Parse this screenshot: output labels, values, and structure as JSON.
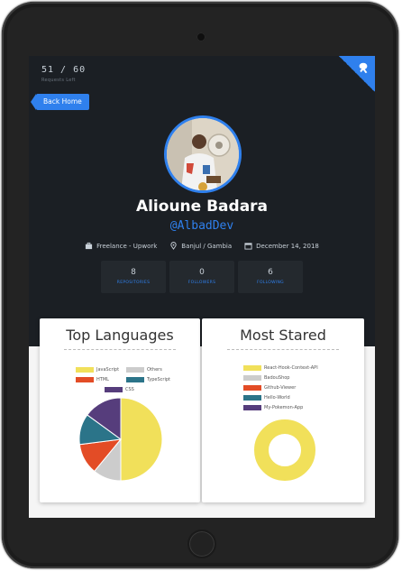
{
  "rate_limit": {
    "count": "51 / 60",
    "label": "Requests Left"
  },
  "nav": {
    "back_label": "Back Home"
  },
  "profile": {
    "name": "Alioune Badara",
    "handle": "@AlbadDev",
    "company": "Freelance - Upwork",
    "location": "Banjul / Gambia",
    "joined": "December 14, 2018"
  },
  "stats": [
    {
      "value": "8",
      "label": "REPOSITORIES"
    },
    {
      "value": "0",
      "label": "FOLLOWERS"
    },
    {
      "value": "6",
      "label": "FOLLOWING"
    }
  ],
  "colors": {
    "accent": "#2f80ed",
    "header_bg": "#1b1f24",
    "stat_bg": "#24292e"
  },
  "icons": {
    "corner": "github-octocat-icon",
    "company": "briefcase-icon",
    "location": "map-pin-icon",
    "joined": "calendar-icon"
  },
  "chart_data": [
    {
      "type": "pie",
      "title": "Top Languages",
      "labels": [
        "JavaScript",
        "Others",
        "HTML",
        "TypeScript",
        "CSS"
      ],
      "colors": [
        "#f1e05a",
        "#cccccc",
        "#e34c26",
        "#2b7489",
        "#563d7c"
      ],
      "values": [
        50,
        11,
        12,
        12,
        15
      ]
    },
    {
      "type": "pie",
      "title": "Most Stared",
      "doughnut": true,
      "labels": [
        "React-Hook-Context-API",
        "BadouShop",
        "Github-Viewer",
        "Hello-World",
        "My-Pokemon-App"
      ],
      "colors": [
        "#f1e05a",
        "#cccccc",
        "#e34c26",
        "#2b7489",
        "#563d7c"
      ],
      "values": [
        100,
        0,
        0,
        0,
        0
      ]
    }
  ]
}
